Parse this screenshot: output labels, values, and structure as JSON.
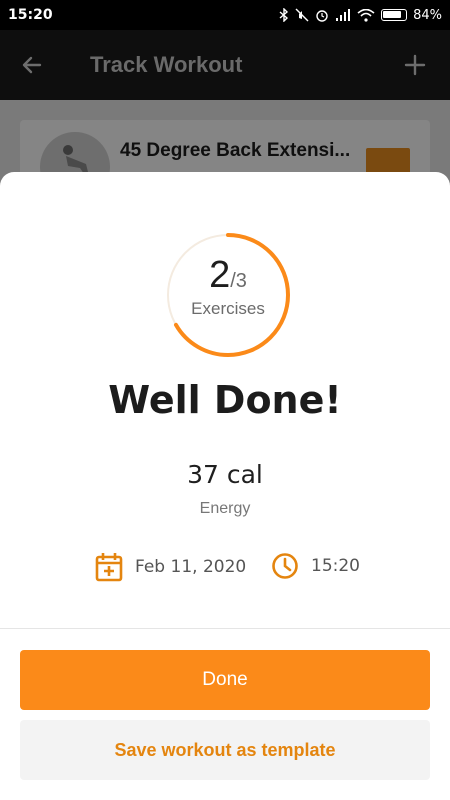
{
  "status_bar": {
    "time": "15:20",
    "battery": "84%"
  },
  "header": {
    "title": "Track Workout"
  },
  "background_list": {
    "exercise_name": "45 Degree Back Extensi..."
  },
  "summary": {
    "completed": "2",
    "total": "/3",
    "progress_fraction": 0.6667,
    "progress_label": "Exercises",
    "heading": "Well Done!",
    "energy_value": "37 cal",
    "energy_label": "Energy",
    "date": "Feb 11, 2020",
    "time": "15:20"
  },
  "actions": {
    "done_label": "Done",
    "template_label": "Save workout as template"
  },
  "colors": {
    "accent": "#fb8a19",
    "accent_text": "#e4850f"
  },
  "icons": [
    "back-arrow-icon",
    "plus-icon",
    "calendar-icon",
    "clock-icon"
  ]
}
